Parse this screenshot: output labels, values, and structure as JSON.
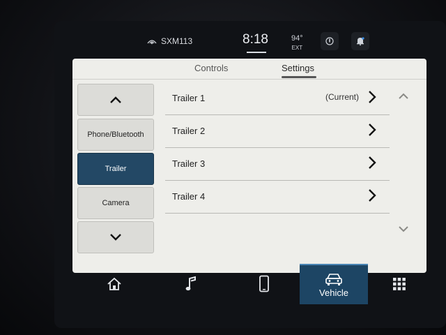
{
  "status": {
    "radio": "SXM113",
    "time": "8:18",
    "temp": "94°",
    "temp_unit": "EXT",
    "icons": [
      "siriusxm-icon",
      "driver-assist-icon",
      "notification-bell-icon"
    ]
  },
  "tabs": [
    {
      "label": "Controls",
      "active": false
    },
    {
      "label": "Settings",
      "active": true
    }
  ],
  "sidebar": {
    "up_icon": "chevron-up-icon",
    "items": [
      {
        "label": "Phone/Bluetooth",
        "active": false
      },
      {
        "label": "Trailer",
        "active": true
      },
      {
        "label": "Camera",
        "active": false
      }
    ],
    "down_icon": "chevron-down-icon"
  },
  "list": {
    "rows": [
      {
        "label": "Trailer 1",
        "status": "(Current)"
      },
      {
        "label": "Trailer 2",
        "status": ""
      },
      {
        "label": "Trailer 3",
        "status": ""
      },
      {
        "label": "Trailer 4",
        "status": ""
      }
    ]
  },
  "nav": {
    "items": [
      {
        "icon": "home-icon",
        "label": ""
      },
      {
        "icon": "music-note-icon",
        "label": ""
      },
      {
        "icon": "phone-icon",
        "label": ""
      },
      {
        "icon": "vehicle-icon",
        "label": "Vehicle",
        "active": true
      },
      {
        "icon": "apps-grid-icon",
        "label": ""
      }
    ]
  },
  "colors": {
    "panel_bg": "#eeeeea",
    "active_tile": "#234865",
    "nav_active": "#1d4564"
  }
}
